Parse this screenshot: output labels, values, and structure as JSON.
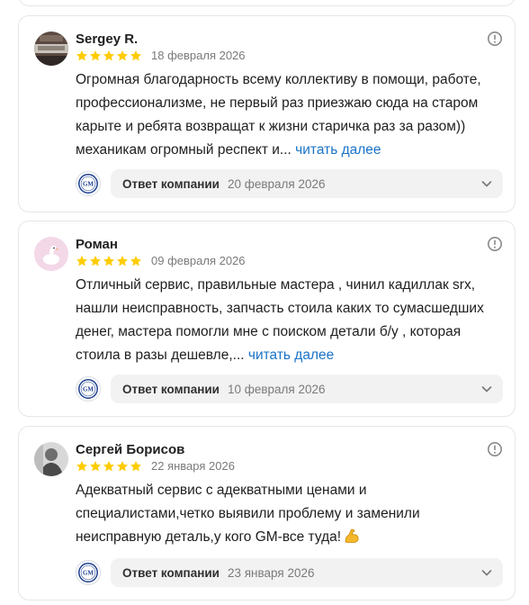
{
  "reviews": [
    {
      "author": "Sergey R.",
      "rating": 5,
      "date": "18 февраля 2026",
      "text": "Огромная благодарность всему коллективу в помощи, работе, профессионализме, не первый раз приезжаю сюда на старом карыте и ребята возвращат к жизни старичка раз за разом)) механикам огромный респект и...",
      "more": "читать далее",
      "reply_label": "Ответ компании",
      "reply_date": "20 февраля 2026"
    },
    {
      "author": "Роман",
      "rating": 5,
      "date": "09 февраля 2026",
      "text": "Отличный сервис, правильные мастера , чинил кадиллак srx, нашли неисправность, запчасть стоила каких то сумасшедших денег, мастера помогли мне с поиском детали б/у , которая стоила в разы дешевле,...",
      "more": "читать далее",
      "reply_label": "Ответ компании",
      "reply_date": "10 февраля 2026"
    },
    {
      "author": "Сергей Борисов",
      "rating": 5,
      "date": "22 января 2026",
      "text": "Адекватный сервис с адекватными ценами и специалистами,четко выявили проблему и заменили неисправную деталь,у кого GM-все туда!",
      "more": "",
      "reply_label": "Ответ компании",
      "reply_date": "23 января 2026"
    }
  ],
  "company_logo_text": "GM",
  "colors": {
    "star": "#fc0",
    "link": "#1a73c8",
    "reply_bg": "#f2f2f2",
    "emoji": "flexed-biceps"
  }
}
